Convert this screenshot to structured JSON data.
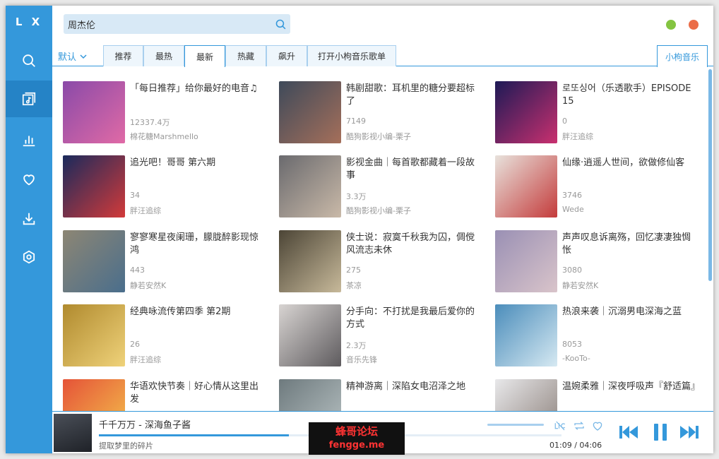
{
  "app": {
    "logo": "L X"
  },
  "search": {
    "value": "周杰伦",
    "placeholder": ""
  },
  "sidebar": {
    "items": [
      {
        "name": "search",
        "icon": "search-icon",
        "active": false
      },
      {
        "name": "songlist",
        "icon": "songlist-icon",
        "active": true
      },
      {
        "name": "leaderboard",
        "icon": "chart-icon",
        "active": false
      },
      {
        "name": "favorites",
        "icon": "heart-icon",
        "active": false
      },
      {
        "name": "download",
        "icon": "download-icon",
        "active": false
      },
      {
        "name": "settings",
        "icon": "settings-icon",
        "active": false
      }
    ]
  },
  "tabs": {
    "sort_label": "默认",
    "items": [
      "推荐",
      "最热",
      "最新",
      "热藏",
      "飙升",
      "打开小枸音乐歌单"
    ],
    "active_index": 2,
    "source": "小枸音乐"
  },
  "playlists": [
    {
      "title": "「每日推荐」给你最好的电音♫",
      "count": "12337.4万",
      "author": "棉花糖Marshmello",
      "colors": [
        "#8a4aa8",
        "#e06aa6"
      ]
    },
    {
      "title": "韩剧甜歌：耳机里的糖分要超标了",
      "count": "7149",
      "author": "酷狗影视小编-栗子",
      "colors": [
        "#3e4a5a",
        "#a56f5a"
      ]
    },
    {
      "title": "로또싱어（乐透歌手）EPISODE 15",
      "count": "0",
      "author": "胖汪追综",
      "colors": [
        "#1d1a56",
        "#c9306f"
      ]
    },
    {
      "title": "追光吧！哥哥 第六期",
      "count": "34",
      "author": "胖汪追综",
      "colors": [
        "#1a2a5c",
        "#d23a3a"
      ]
    },
    {
      "title": "影视金曲｜每首歌都藏着一段故事",
      "count": "3.3万",
      "author": "酷狗影视小编-栗子",
      "colors": [
        "#6a6a6e",
        "#c9b9a8"
      ]
    },
    {
      "title": "仙缘·逍遥人世间，欲做修仙客",
      "count": "3746",
      "author": "Wede",
      "colors": [
        "#e8e2dc",
        "#c43b3b"
      ]
    },
    {
      "title": "寥寥寒星夜阑珊，朦胧醉影现惊鸿",
      "count": "443",
      "author": "静若安然K",
      "colors": [
        "#8d8674",
        "#4a6e8c"
      ]
    },
    {
      "title": "侠士说：寂寞千秋我为囚，倜傥风流志未休",
      "count": "275",
      "author": "茶凉",
      "colors": [
        "#4c4536",
        "#c7b99a"
      ]
    },
    {
      "title": "声声叹息诉离殇，回忆凄凄独惆怅",
      "count": "3080",
      "author": "静若安然K",
      "colors": [
        "#9a90b4",
        "#d9c4ca"
      ]
    },
    {
      "title": "经典咏流传第四季 第2期",
      "count": "26",
      "author": "胖汪追综",
      "colors": [
        "#b08a2e",
        "#efd27a"
      ]
    },
    {
      "title": "分手向：不打扰是我最后爱你的方式",
      "count": "2.3万",
      "author": "音乐先锋",
      "colors": [
        "#d8d4d2",
        "#5e5b5e"
      ]
    },
    {
      "title": "热浪来袭｜沉溺男电深海之蓝",
      "count": "8053",
      "author": "-KooTo-",
      "colors": [
        "#4b8dbb",
        "#d6e9f2"
      ]
    },
    {
      "title": "华语欢快节奏｜好心情从这里出发",
      "count": "",
      "author": "",
      "colors": [
        "#e55338",
        "#f4c24c"
      ]
    },
    {
      "title": "精神游离｜深陷女电沼泽之地",
      "count": "",
      "author": "",
      "colors": [
        "#6e7a7e",
        "#b9c3c4"
      ]
    },
    {
      "title": "温婉柔雅｜深夜呼吸声『舒适篇』",
      "count": "",
      "author": "",
      "colors": [
        "#e8e8ea",
        "#8a7e78"
      ]
    }
  ],
  "player": {
    "title": "千千万万 - 深海鱼子酱",
    "lyric": "提取梦里的碎片",
    "time_current": "01:09",
    "time_sep": "/",
    "time_total": "04:06",
    "progress": 0.41
  },
  "watermark": {
    "line1": "蜂哥论坛",
    "line2": "fengge.me"
  }
}
